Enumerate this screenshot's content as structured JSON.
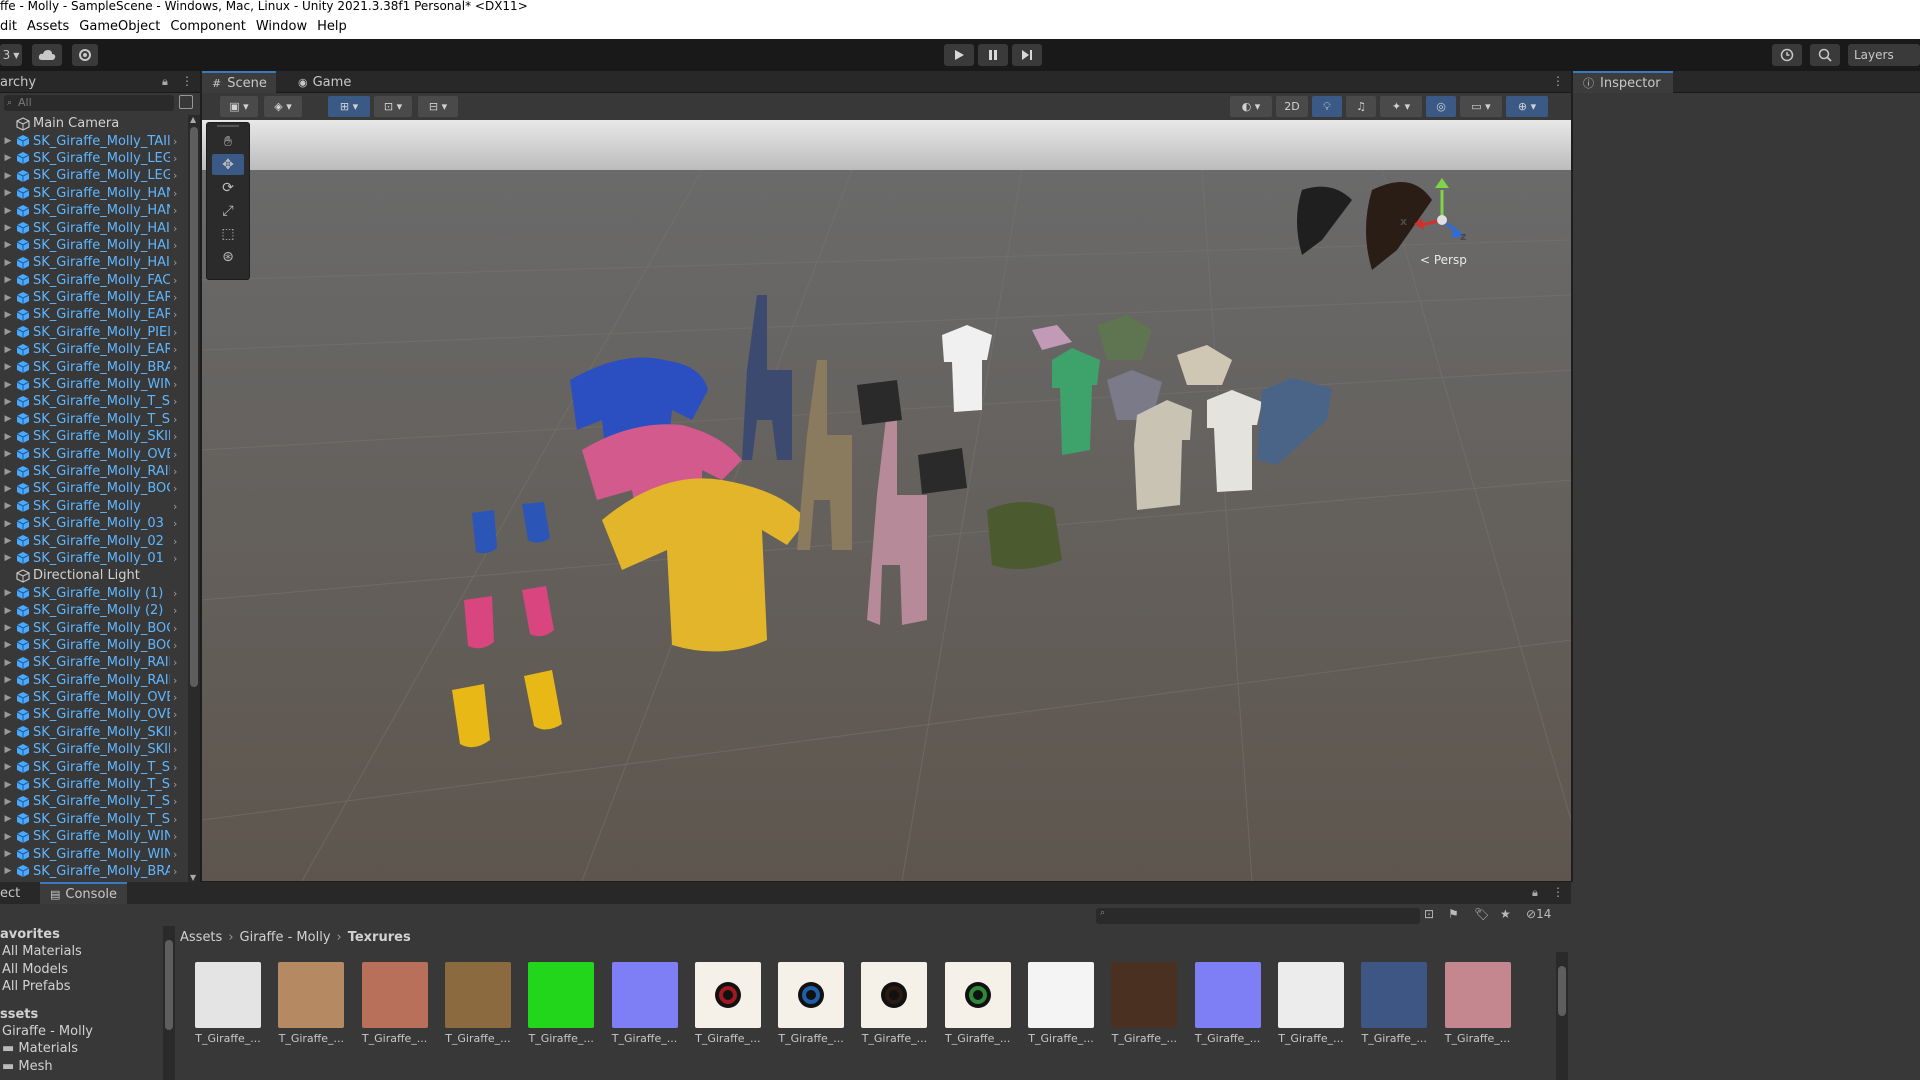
{
  "window": {
    "title": "ffe - Molly - SampleScene - Windows, Mac, Linux - Unity 2021.3.38f1 Personal* <DX11>"
  },
  "menu": [
    "dit",
    "Assets",
    "GameObject",
    "Component",
    "Window",
    "Help"
  ],
  "toolbar": {
    "account_label": "3",
    "layers_label": "Layers",
    "play_icon": "play-icon",
    "pause_icon": "pause-icon",
    "step_icon": "step-icon"
  },
  "hierarchy": {
    "tab_label": "archy",
    "search_placeholder": "All",
    "items": [
      {
        "label": "Main Camera",
        "type": "camera",
        "expand": false
      },
      {
        "label": "SK_Giraffe_Molly_TAIl",
        "type": "prefab",
        "expand": true
      },
      {
        "label": "SK_Giraffe_Molly_LEG",
        "type": "prefab",
        "expand": true
      },
      {
        "label": "SK_Giraffe_Molly_LEG",
        "type": "prefab",
        "expand": true
      },
      {
        "label": "SK_Giraffe_Molly_HAN",
        "type": "prefab",
        "expand": true
      },
      {
        "label": "SK_Giraffe_Molly_HAN",
        "type": "prefab",
        "expand": true
      },
      {
        "label": "SK_Giraffe_Molly_HAI",
        "type": "prefab",
        "expand": true
      },
      {
        "label": "SK_Giraffe_Molly_HAI",
        "type": "prefab",
        "expand": true
      },
      {
        "label": "SK_Giraffe_Molly_HAI",
        "type": "prefab",
        "expand": true
      },
      {
        "label": "SK_Giraffe_Molly_FAC",
        "type": "prefab",
        "expand": true
      },
      {
        "label": "SK_Giraffe_Molly_EAR",
        "type": "prefab",
        "expand": true
      },
      {
        "label": "SK_Giraffe_Molly_EAR",
        "type": "prefab",
        "expand": true
      },
      {
        "label": "SK_Giraffe_Molly_PIEl",
        "type": "prefab",
        "expand": true
      },
      {
        "label": "SK_Giraffe_Molly_EAR",
        "type": "prefab",
        "expand": true
      },
      {
        "label": "SK_Giraffe_Molly_BRA",
        "type": "prefab",
        "expand": true
      },
      {
        "label": "SK_Giraffe_Molly_WIN",
        "type": "prefab",
        "expand": true
      },
      {
        "label": "SK_Giraffe_Molly_T_S",
        "type": "prefab",
        "expand": true
      },
      {
        "label": "SK_Giraffe_Molly_T_S",
        "type": "prefab",
        "expand": true
      },
      {
        "label": "SK_Giraffe_Molly_SKII",
        "type": "prefab",
        "expand": true
      },
      {
        "label": "SK_Giraffe_Molly_OVE",
        "type": "prefab",
        "expand": true
      },
      {
        "label": "SK_Giraffe_Molly_RAII",
        "type": "prefab",
        "expand": true
      },
      {
        "label": "SK_Giraffe_Molly_BOC",
        "type": "prefab",
        "expand": true
      },
      {
        "label": "SK_Giraffe_Molly",
        "type": "prefab",
        "expand": true
      },
      {
        "label": "SK_Giraffe_Molly_03",
        "type": "prefab",
        "expand": true
      },
      {
        "label": "SK_Giraffe_Molly_02",
        "type": "prefab",
        "expand": true
      },
      {
        "label": "SK_Giraffe_Molly_01",
        "type": "prefab",
        "expand": true
      },
      {
        "label": "Directional Light",
        "type": "light",
        "expand": false
      },
      {
        "label": "SK_Giraffe_Molly (1)",
        "type": "prefab",
        "expand": true
      },
      {
        "label": "SK_Giraffe_Molly (2)",
        "type": "prefab",
        "expand": true
      },
      {
        "label": "SK_Giraffe_Molly_BOC",
        "type": "prefab",
        "expand": true
      },
      {
        "label": "SK_Giraffe_Molly_BOC",
        "type": "prefab",
        "expand": true
      },
      {
        "label": "SK_Giraffe_Molly_RAII",
        "type": "prefab",
        "expand": true
      },
      {
        "label": "SK_Giraffe_Molly_RAII",
        "type": "prefab",
        "expand": true
      },
      {
        "label": "SK_Giraffe_Molly_OVE",
        "type": "prefab",
        "expand": true
      },
      {
        "label": "SK_Giraffe_Molly_OVE",
        "type": "prefab",
        "expand": true
      },
      {
        "label": "SK_Giraffe_Molly_SKII",
        "type": "prefab",
        "expand": true
      },
      {
        "label": "SK_Giraffe_Molly_SKII",
        "type": "prefab",
        "expand": true
      },
      {
        "label": "SK_Giraffe_Molly_T_S",
        "type": "prefab",
        "expand": true
      },
      {
        "label": "SK_Giraffe_Molly_T_S",
        "type": "prefab",
        "expand": true
      },
      {
        "label": "SK_Giraffe_Molly_T_S",
        "type": "prefab",
        "expand": true
      },
      {
        "label": "SK_Giraffe_Molly_T_S",
        "type": "prefab",
        "expand": true
      },
      {
        "label": "SK_Giraffe_Molly_WIN",
        "type": "prefab",
        "expand": true
      },
      {
        "label": "SK_Giraffe_Molly_WIN",
        "type": "prefab",
        "expand": true
      },
      {
        "label": "SK_Giraffe_Molly_BRA",
        "type": "prefab",
        "expand": true
      }
    ]
  },
  "scene": {
    "tabs": [
      "Scene",
      "Game"
    ],
    "toggle_2d": "2D",
    "persp_label": "< Persp",
    "gizmo_x": "x",
    "gizmo_z": "z"
  },
  "inspector": {
    "tab_label": "Inspector"
  },
  "project": {
    "tabs": [
      "ect",
      "Console"
    ],
    "hidden_count": "14",
    "favorites": {
      "header": "avorites",
      "items": [
        "All Materials",
        "All Models",
        "All Prefabs"
      ]
    },
    "assets_tree": {
      "header": "ssets",
      "items": [
        "Giraffe - Molly",
        "Materials",
        "Mesh"
      ]
    },
    "breadcrumb": [
      "Assets",
      "Giraffe - Molly",
      "Texrures"
    ],
    "assets": [
      {
        "name": "T_Giraffe_...",
        "color": "#e4e4e4"
      },
      {
        "name": "T_Giraffe_...",
        "color": "#b58a63"
      },
      {
        "name": "T_Giraffe_...",
        "color": "#b9705a"
      },
      {
        "name": "T_Giraffe_...",
        "color": "#8a6a3e"
      },
      {
        "name": "T_Giraffe_...",
        "color": "#22d61c"
      },
      {
        "name": "T_Giraffe_...",
        "color": "#7f7ff5"
      },
      {
        "name": "T_Giraffe_...",
        "color": "#f5f0e8"
      },
      {
        "name": "T_Giraffe_...",
        "color": "#f5f0e8"
      },
      {
        "name": "T_Giraffe_...",
        "color": "#f5f0e8"
      },
      {
        "name": "T_Giraffe_...",
        "color": "#f5f0e8"
      },
      {
        "name": "T_Giraffe_...",
        "color": "#f4f4f4"
      },
      {
        "name": "T_Giraffe_...",
        "color": "#4a3020"
      },
      {
        "name": "T_Giraffe_...",
        "color": "#7f7ff5"
      },
      {
        "name": "T_Giraffe_...",
        "color": "#ececec"
      },
      {
        "name": "T_Giraffe_...",
        "color": "#3e5683"
      },
      {
        "name": "T_Giraffe_...",
        "color": "#c4868f"
      }
    ]
  },
  "colors": {
    "accent": "#3a79bb",
    "prefab_text": "#5fb6ff",
    "panel_bg": "#383838",
    "dark_bg": "#282828"
  }
}
